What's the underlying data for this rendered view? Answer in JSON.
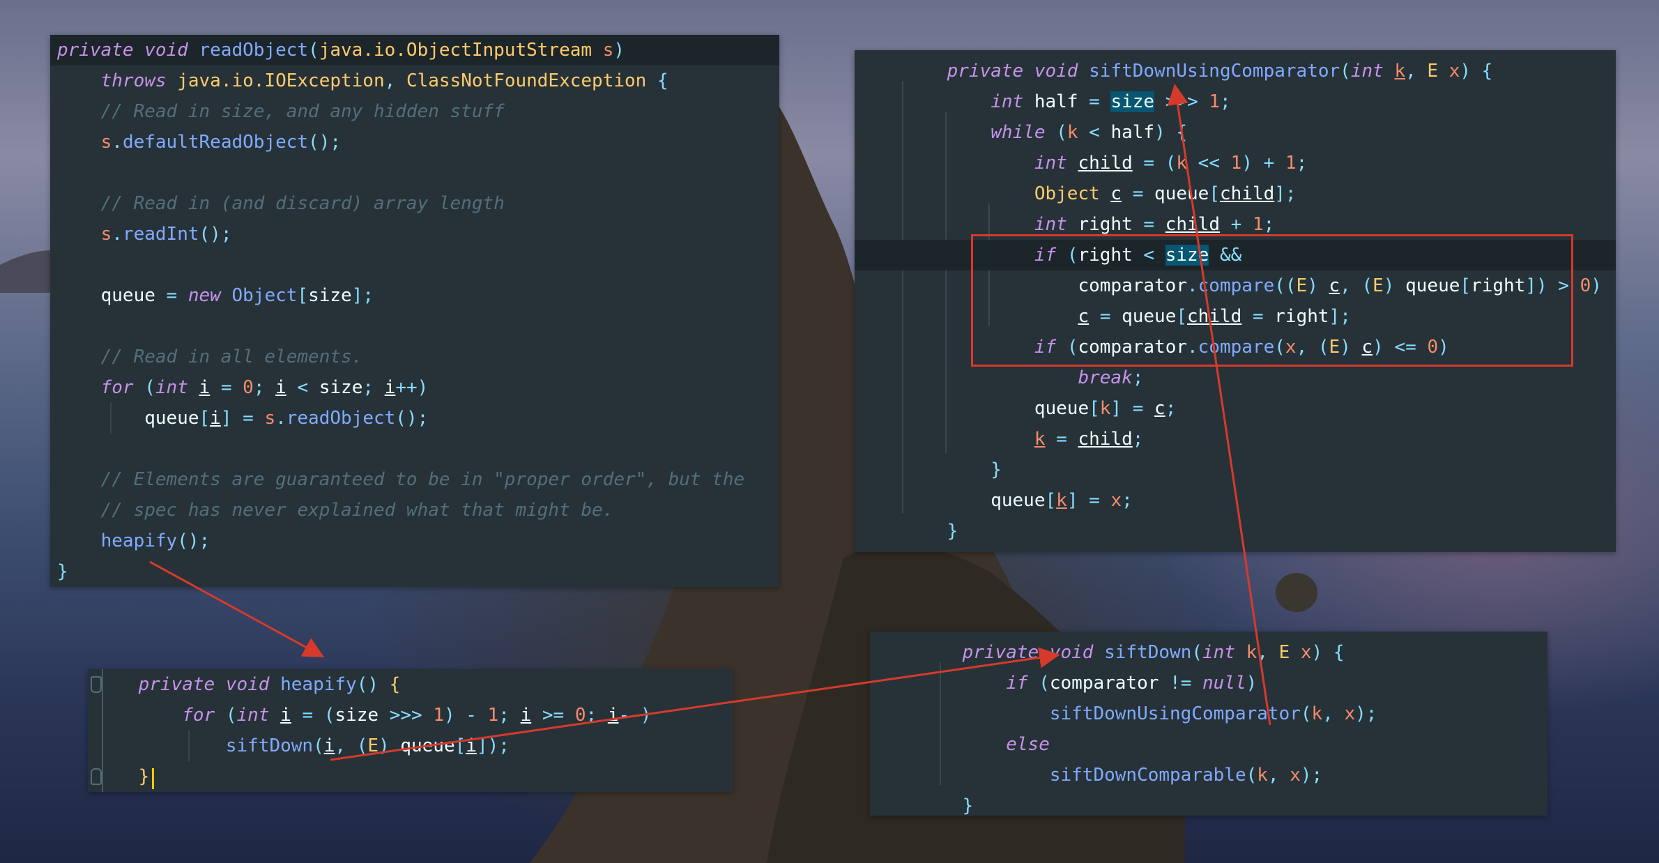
{
  "colors": {
    "panel_bg": "#263238",
    "keyword": "#c792ea",
    "type": "#ffcb6b",
    "function": "#82aaff",
    "number": "#f78c6c",
    "operator": "#89ddff",
    "comment": "#546e7a",
    "text": "#eeffff",
    "annotation_red": "#d63a2b"
  },
  "panels": {
    "read_object": {
      "lines": [
        [
          [
            "kw",
            "private void "
          ],
          [
            "fn",
            "readObject"
          ],
          [
            "op",
            "("
          ],
          [
            "ty",
            "java.io.ObjectInputStream "
          ],
          [
            "pa",
            "s"
          ],
          [
            "op",
            ")"
          ]
        ],
        [
          [
            "tx",
            "    "
          ],
          [
            "kw",
            "throws "
          ],
          [
            "ty",
            "java.io.IOException"
          ],
          [
            "op",
            ", "
          ],
          [
            "ty",
            "ClassNotFoundException "
          ],
          [
            "op",
            "{"
          ]
        ],
        [
          [
            "tx",
            "    "
          ],
          [
            "cm",
            "// Read in size, and any hidden stuff"
          ]
        ],
        [
          [
            "tx",
            "    "
          ],
          [
            "pa",
            "s"
          ],
          [
            "op",
            "."
          ],
          [
            "fn",
            "defaultReadObject"
          ],
          [
            "op",
            "();"
          ]
        ],
        [],
        [
          [
            "tx",
            "    "
          ],
          [
            "cm",
            "// Read in (and discard) array length"
          ]
        ],
        [
          [
            "tx",
            "    "
          ],
          [
            "pa",
            "s"
          ],
          [
            "op",
            "."
          ],
          [
            "fn",
            "readInt"
          ],
          [
            "op",
            "();"
          ]
        ],
        [],
        [
          [
            "tx",
            "    queue "
          ],
          [
            "op",
            "= "
          ],
          [
            "kw",
            "new "
          ],
          [
            "fn",
            "Object"
          ],
          [
            "op",
            "["
          ],
          [
            "tx",
            "size"
          ],
          [
            "op",
            "];"
          ]
        ],
        [],
        [
          [
            "tx",
            "    "
          ],
          [
            "cm",
            "// Read in all elements."
          ]
        ],
        [
          [
            "tx",
            "    "
          ],
          [
            "kw",
            "for "
          ],
          [
            "op",
            "("
          ],
          [
            "kw",
            "int "
          ],
          [
            "tx",
            "@i@"
          ],
          [
            "op",
            " = "
          ],
          [
            "num",
            "0"
          ],
          [
            "op",
            "; "
          ],
          [
            "tx",
            "@i@"
          ],
          [
            "op",
            " < "
          ],
          [
            "tx",
            "size"
          ],
          [
            "op",
            "; "
          ],
          [
            "tx",
            "@i@"
          ],
          [
            "op",
            "++)"
          ]
        ],
        [
          [
            "tx",
            "        queue"
          ],
          [
            "op",
            "["
          ],
          [
            "tx",
            "@i@"
          ],
          [
            "op",
            "] = "
          ],
          [
            "pa",
            "s"
          ],
          [
            "op",
            "."
          ],
          [
            "fn",
            "readObject"
          ],
          [
            "op",
            "();"
          ]
        ],
        [],
        [
          [
            "tx",
            "    "
          ],
          [
            "cm",
            "// Elements are guaranteed to be in \"proper order\", but the"
          ]
        ],
        [
          [
            "tx",
            "    "
          ],
          [
            "cm",
            "// spec has never explained what that might be."
          ]
        ],
        [
          [
            "tx",
            "    "
          ],
          [
            "fn",
            "heapify"
          ],
          [
            "op",
            "();"
          ]
        ],
        [
          [
            "op",
            "}"
          ]
        ]
      ]
    },
    "sift_down_using_comparator": {
      "lines": [
        [
          [
            "tx",
            "    "
          ],
          [
            "kw",
            "private void "
          ],
          [
            "fn",
            "siftDownUsingComparator"
          ],
          [
            "op",
            "("
          ],
          [
            "kw",
            "int "
          ],
          [
            "pa",
            "@k@"
          ],
          [
            "op",
            ", "
          ],
          [
            "ty",
            "E "
          ],
          [
            "pa",
            "x"
          ],
          [
            "op",
            ") {"
          ]
        ],
        [
          [
            "tx",
            "        "
          ],
          [
            "kw",
            "int "
          ],
          [
            "tx",
            "half "
          ],
          [
            "op",
            "= "
          ],
          [
            "hls",
            "size"
          ],
          [
            "op",
            " >>> "
          ],
          [
            "num",
            "1"
          ],
          [
            "op",
            ";"
          ]
        ],
        [
          [
            "tx",
            "        "
          ],
          [
            "kw",
            "while "
          ],
          [
            "op",
            "("
          ],
          [
            "pa",
            "k"
          ],
          [
            "op",
            " < "
          ],
          [
            "tx",
            "half"
          ],
          [
            "op",
            ") {"
          ]
        ],
        [
          [
            "tx",
            "            "
          ],
          [
            "kw",
            "int "
          ],
          [
            "tx",
            "@child@"
          ],
          [
            "op",
            " = ("
          ],
          [
            "pa",
            "k"
          ],
          [
            "op",
            " << "
          ],
          [
            "num",
            "1"
          ],
          [
            "op",
            ") + "
          ],
          [
            "num",
            "1"
          ],
          [
            "op",
            ";"
          ]
        ],
        [
          [
            "tx",
            "            "
          ],
          [
            "ty",
            "Object "
          ],
          [
            "tx",
            "@c@"
          ],
          [
            "op",
            " = "
          ],
          [
            "tx",
            "queue"
          ],
          [
            "op",
            "["
          ],
          [
            "tx",
            "@child@"
          ],
          [
            "op",
            "];"
          ]
        ],
        [
          [
            "tx",
            "            "
          ],
          [
            "kw",
            "int "
          ],
          [
            "tx",
            "right "
          ],
          [
            "op",
            "= "
          ],
          [
            "tx",
            "@child@"
          ],
          [
            "op",
            " + "
          ],
          [
            "num",
            "1"
          ],
          [
            "op",
            ";"
          ]
        ],
        [
          [
            "tx",
            "            "
          ],
          [
            "kw",
            "if "
          ],
          [
            "op",
            "("
          ],
          [
            "tx",
            "right "
          ],
          [
            "op",
            "< "
          ],
          [
            "hls",
            "size"
          ],
          [
            "op",
            " &&"
          ]
        ],
        [
          [
            "tx",
            "                comparator"
          ],
          [
            "op",
            "."
          ],
          [
            "fn",
            "compare"
          ],
          [
            "op",
            "(("
          ],
          [
            "ty",
            "E"
          ],
          [
            "op",
            ") "
          ],
          [
            "tx",
            "@c@"
          ],
          [
            "op",
            ", ("
          ],
          [
            "ty",
            "E"
          ],
          [
            "op",
            ") "
          ],
          [
            "tx",
            "queue"
          ],
          [
            "op",
            "["
          ],
          [
            "tx",
            "right"
          ],
          [
            "op",
            "]) > "
          ],
          [
            "num",
            "0"
          ],
          [
            "op",
            ")"
          ]
        ],
        [
          [
            "tx",
            "                "
          ],
          [
            "tx",
            "@c@"
          ],
          [
            "op",
            " = "
          ],
          [
            "tx",
            "queue"
          ],
          [
            "op",
            "["
          ],
          [
            "tx",
            "@child@"
          ],
          [
            "op",
            " = "
          ],
          [
            "tx",
            "right"
          ],
          [
            "op",
            "];"
          ]
        ],
        [
          [
            "tx",
            "            "
          ],
          [
            "kw",
            "if "
          ],
          [
            "op",
            "("
          ],
          [
            "tx",
            "comparator"
          ],
          [
            "op",
            "."
          ],
          [
            "fn",
            "compare"
          ],
          [
            "op",
            "("
          ],
          [
            "pa",
            "x"
          ],
          [
            "op",
            ", ("
          ],
          [
            "ty",
            "E"
          ],
          [
            "op",
            ") "
          ],
          [
            "tx",
            "@c@"
          ],
          [
            "op",
            ") <= "
          ],
          [
            "num",
            "0"
          ],
          [
            "op",
            ")"
          ]
        ],
        [
          [
            "tx",
            "                "
          ],
          [
            "kw",
            "break"
          ],
          [
            "op",
            ";"
          ]
        ],
        [
          [
            "tx",
            "            queue"
          ],
          [
            "op",
            "["
          ],
          [
            "pa",
            "k"
          ],
          [
            "op",
            "] = "
          ],
          [
            "tx",
            "@c@"
          ],
          [
            "op",
            ";"
          ]
        ],
        [
          [
            "tx",
            "            "
          ],
          [
            "pa",
            "@k@"
          ],
          [
            "op",
            " = "
          ],
          [
            "tx",
            "@child@"
          ],
          [
            "op",
            ";"
          ]
        ],
        [
          [
            "tx",
            "        "
          ],
          [
            "op",
            "}"
          ]
        ],
        [
          [
            "tx",
            "        queue"
          ],
          [
            "op",
            "["
          ],
          [
            "pa",
            "@k@"
          ],
          [
            "op",
            "] = "
          ],
          [
            "pa",
            "x"
          ],
          [
            "op",
            ";"
          ]
        ],
        [
          [
            "tx",
            "    "
          ],
          [
            "op",
            "}"
          ]
        ]
      ]
    },
    "heapify": {
      "lines": [
        [
          [
            "tx",
            "    "
          ],
          [
            "kw",
            "private void "
          ],
          [
            "fn",
            "heapify"
          ],
          [
            "op",
            "() "
          ],
          [
            "ty",
            "{"
          ]
        ],
        [
          [
            "tx",
            "        "
          ],
          [
            "kw",
            "for "
          ],
          [
            "op",
            "("
          ],
          [
            "kw",
            "int "
          ],
          [
            "tx",
            "@i@"
          ],
          [
            "op",
            " = ("
          ],
          [
            "tx",
            "size"
          ],
          [
            "op",
            " >>> "
          ],
          [
            "num",
            "1"
          ],
          [
            "op",
            ") - "
          ],
          [
            "num",
            "1"
          ],
          [
            "op",
            "; "
          ],
          [
            "tx",
            "@i@"
          ],
          [
            "op",
            " >= "
          ],
          [
            "num",
            "0"
          ],
          [
            "op",
            "; "
          ],
          [
            "tx",
            "@i@"
          ],
          [
            "op",
            "--)"
          ]
        ],
        [
          [
            "tx",
            "            "
          ],
          [
            "fn",
            "siftDown"
          ],
          [
            "op",
            "("
          ],
          [
            "tx",
            "@i@"
          ],
          [
            "op",
            ", ("
          ],
          [
            "ty",
            "E"
          ],
          [
            "op",
            ") "
          ],
          [
            "tx",
            "queue"
          ],
          [
            "op",
            "["
          ],
          [
            "tx",
            "@i@"
          ],
          [
            "op",
            "]);"
          ]
        ],
        [
          [
            "tx",
            "    "
          ],
          [
            "ty",
            "}"
          ]
        ]
      ]
    },
    "sift_down": {
      "lines": [
        [
          [
            "tx",
            "    "
          ],
          [
            "kw",
            "private void "
          ],
          [
            "fn",
            "siftDown"
          ],
          [
            "op",
            "("
          ],
          [
            "kw",
            "int "
          ],
          [
            "pa",
            "k"
          ],
          [
            "op",
            ", "
          ],
          [
            "ty",
            "E "
          ],
          [
            "pa",
            "x"
          ],
          [
            "op",
            ") {"
          ]
        ],
        [
          [
            "tx",
            "        "
          ],
          [
            "kw",
            "if "
          ],
          [
            "op",
            "("
          ],
          [
            "tx",
            "comparator"
          ],
          [
            "op",
            " != "
          ],
          [
            "kw",
            "null"
          ],
          [
            "op",
            ")"
          ]
        ],
        [
          [
            "tx",
            "            "
          ],
          [
            "fn",
            "siftDownUsingComparator"
          ],
          [
            "op",
            "("
          ],
          [
            "pa",
            "k"
          ],
          [
            "op",
            ", "
          ],
          [
            "pa",
            "x"
          ],
          [
            "op",
            ");"
          ]
        ],
        [
          [
            "tx",
            "        "
          ],
          [
            "kw",
            "else"
          ]
        ],
        [
          [
            "tx",
            "            "
          ],
          [
            "fn",
            "siftDownComparable"
          ],
          [
            "op",
            "("
          ],
          [
            "pa",
            "k"
          ],
          [
            "op",
            ", "
          ],
          [
            "pa",
            "x"
          ],
          [
            "op",
            ");"
          ]
        ],
        [
          [
            "tx",
            "    "
          ],
          [
            "op",
            "}"
          ]
        ]
      ]
    }
  }
}
